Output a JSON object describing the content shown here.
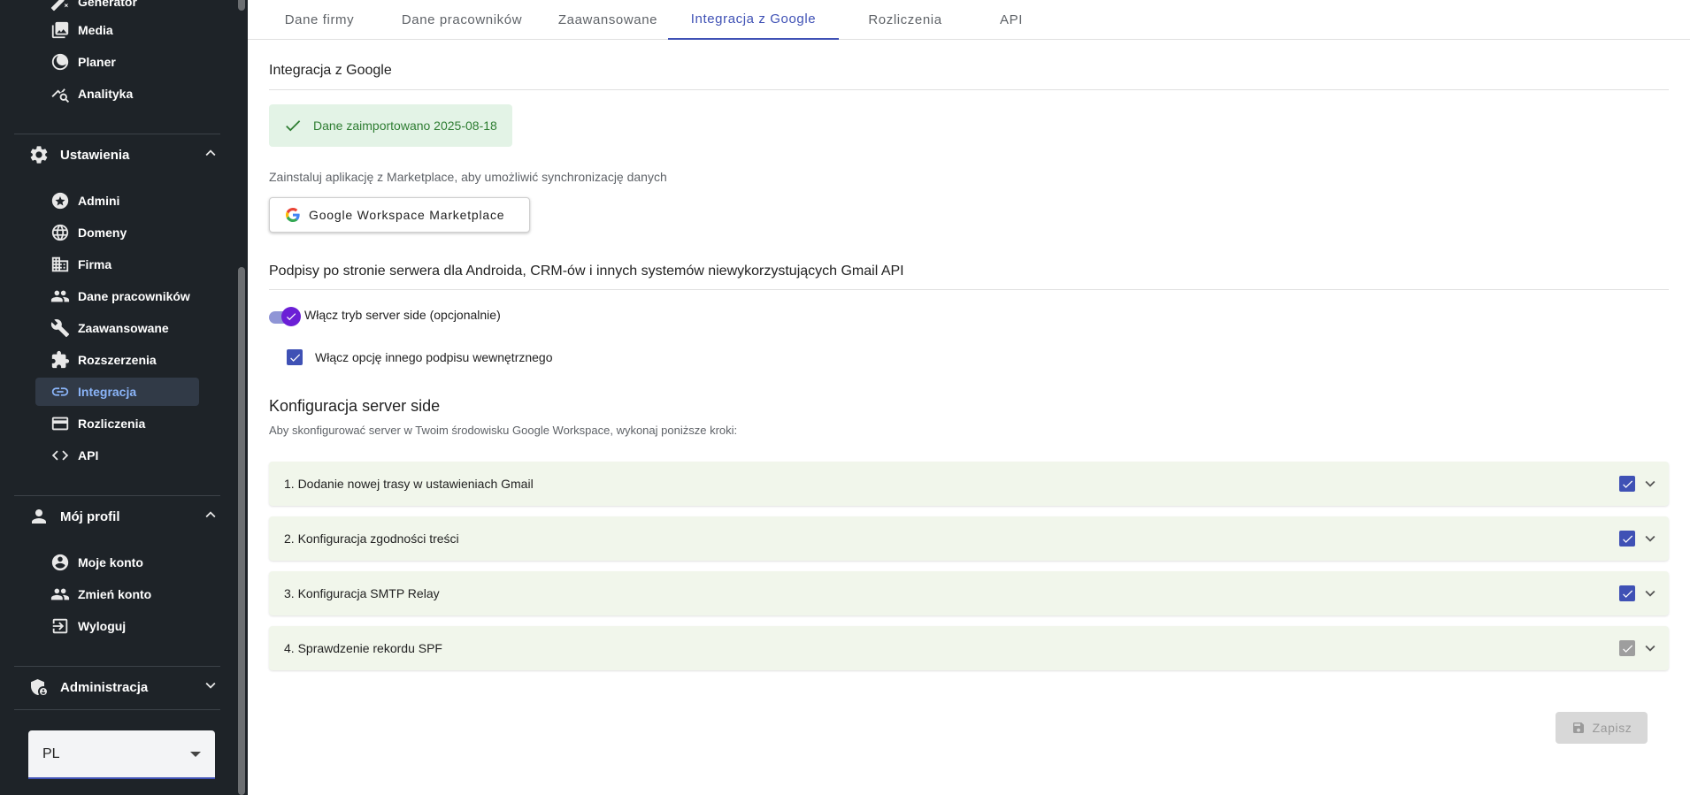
{
  "sidebar": {
    "top_items": [
      {
        "label": "Generator",
        "icon": "magic-icon"
      },
      {
        "label": "Media",
        "icon": "media-icon"
      },
      {
        "label": "Planer",
        "icon": "planner-icon"
      },
      {
        "label": "Analityka",
        "icon": "analytics-icon"
      }
    ],
    "settings_section": {
      "label": "Ustawienia",
      "expanded": true
    },
    "settings_items": [
      {
        "label": "Admini",
        "icon": "star-icon"
      },
      {
        "label": "Domeny",
        "icon": "globe-icon"
      },
      {
        "label": "Firma",
        "icon": "building-icon"
      },
      {
        "label": "Dane pracowników",
        "icon": "people-icon"
      },
      {
        "label": "Zaawansowane",
        "icon": "wrench-icon"
      },
      {
        "label": "Rozszerzenia",
        "icon": "puzzle-icon"
      },
      {
        "label": "Integracja",
        "icon": "link-icon",
        "active": true
      },
      {
        "label": "Rozliczenia",
        "icon": "credit-card-icon"
      },
      {
        "label": "API",
        "icon": "code-icon"
      }
    ],
    "profile_section": {
      "label": "Mój profil",
      "expanded": true
    },
    "profile_items": [
      {
        "label": "Moje konto",
        "icon": "account-circle-icon"
      },
      {
        "label": "Zmień konto",
        "icon": "switch-account-icon"
      },
      {
        "label": "Wyloguj",
        "icon": "logout-icon"
      }
    ],
    "admin_section": {
      "label": "Administracja",
      "expanded": false
    },
    "language": {
      "value": "PL"
    }
  },
  "tabs": [
    {
      "label": "Dane firmy"
    },
    {
      "label": "Dane pracowników"
    },
    {
      "label": "Zaawansowane"
    },
    {
      "label": "Integracja z Google",
      "active": true
    },
    {
      "label": "Rozliczenia"
    },
    {
      "label": "API"
    }
  ],
  "google": {
    "heading": "Integracja z Google",
    "import_status": "Dane zaimportowano 2025-08-18",
    "install_hint": "Zainstaluj aplikację z Marketplace, aby umożliwić synchronizację danych",
    "marketplace_button": "Google Workspace Marketplace"
  },
  "server_side": {
    "heading": "Podpisy po stronie serwera dla Androida, CRM-ów i innych systemów niewykorzystujących Gmail API",
    "toggle_label": "Włącz tryb server side (opcjonalnie)",
    "toggle_on": true,
    "checkbox_label": "Włącz opcję innego podpisu wewnętrznego",
    "checkbox_checked": true
  },
  "config": {
    "heading": "Konfiguracja server side",
    "description": "Aby skonfigurować server w Twoim środowisku Google Workspace, wykonaj poniższe kroki:",
    "steps": [
      {
        "label": "1. Dodanie nowej trasy w ustawieniach Gmail",
        "checked": true,
        "state": "active"
      },
      {
        "label": "2. Konfiguracja zgodności treści",
        "checked": true,
        "state": "active"
      },
      {
        "label": "3. Konfiguracja SMTP Relay",
        "checked": true,
        "state": "active"
      },
      {
        "label": "4. Sprawdzenie rekordu SPF",
        "checked": true,
        "state": "disabled"
      }
    ]
  },
  "actions": {
    "save_label": "Zapisz",
    "save_disabled": true
  },
  "colors": {
    "primary": "#3f51b5",
    "sidebar_bg": "#1e2328",
    "success": "#2e7d32",
    "success_bg": "#e3f3e6",
    "accordion_bg": "#f1f6eb"
  }
}
